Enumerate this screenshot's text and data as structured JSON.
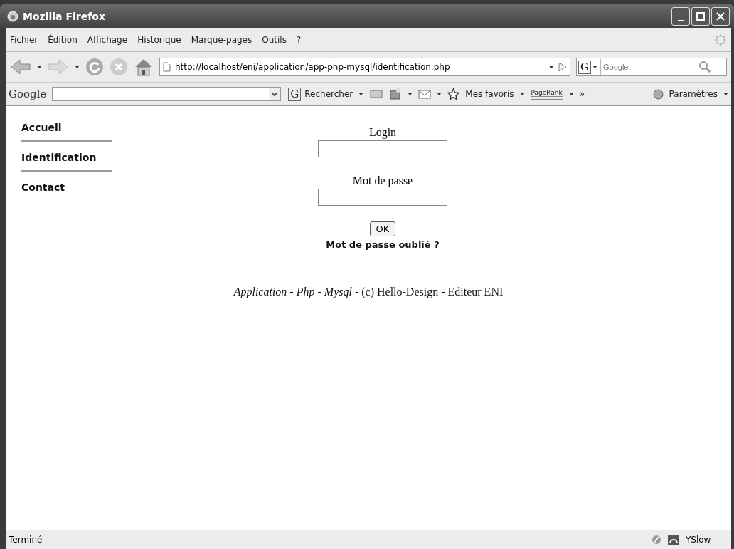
{
  "window": {
    "title": "Mozilla Firefox"
  },
  "menu": [
    "Fichier",
    "Édition",
    "Affichage",
    "Historique",
    "Marque-pages",
    "Outils",
    "?"
  ],
  "address": {
    "value": "http://localhost/eni/application/app-php-mysql/identification.php"
  },
  "search": {
    "engine": "G",
    "placeholder": "Google"
  },
  "google_toolbar": {
    "logo": "Google",
    "engine": "G",
    "search_label": "Rechercher",
    "favorites": "Mes favoris",
    "pagerank": "PageRank",
    "more": "»",
    "settings": "Paramètres"
  },
  "nav": [
    "Accueil",
    "Identification",
    "Contact"
  ],
  "form": {
    "login_label": "Login",
    "password_label": "Mot de passe",
    "submit": "OK",
    "forgot": "Mot de passe oublié ?"
  },
  "footer": "*Application* - *Php* - *Mysql* - (c) Hello-Design - Editeur ENI",
  "status_bar": {
    "text": "Terminé",
    "addon": "YSlow"
  }
}
